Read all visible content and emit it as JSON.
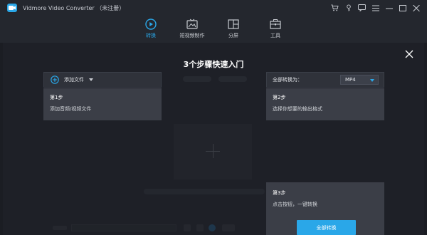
{
  "titlebar": {
    "title": "Vidmore Video Converter （未注册）",
    "icons": [
      "cart-icon",
      "key-icon",
      "feedback-icon",
      "menu-icon",
      "minimize-icon",
      "maximize-icon",
      "close-icon"
    ]
  },
  "nav": {
    "items": [
      {
        "label": "转换",
        "icon": "convert-icon",
        "active": true
      },
      {
        "label": "短视频制作",
        "icon": "mv-icon",
        "active": false
      },
      {
        "label": "分屏",
        "icon": "collage-icon",
        "active": false
      },
      {
        "label": "工具",
        "icon": "toolbox-icon",
        "active": false
      }
    ]
  },
  "guide": {
    "title": "3个步骤快速入门",
    "add_file_label": "添加文件",
    "convert_all_label": "全部转换为：",
    "format_value": "MP4",
    "steps": [
      {
        "title": "第1步",
        "text": "添加音频/视频文件"
      },
      {
        "title": "第2步",
        "text": "选择你想要的输出格式"
      },
      {
        "title": "第3步",
        "text": "点击按钮，一键转换"
      }
    ],
    "convert_all_button": "全部转换"
  },
  "colors": {
    "accent": "#2aa7e8",
    "background": "#24272e",
    "card": "#3b3e47"
  }
}
